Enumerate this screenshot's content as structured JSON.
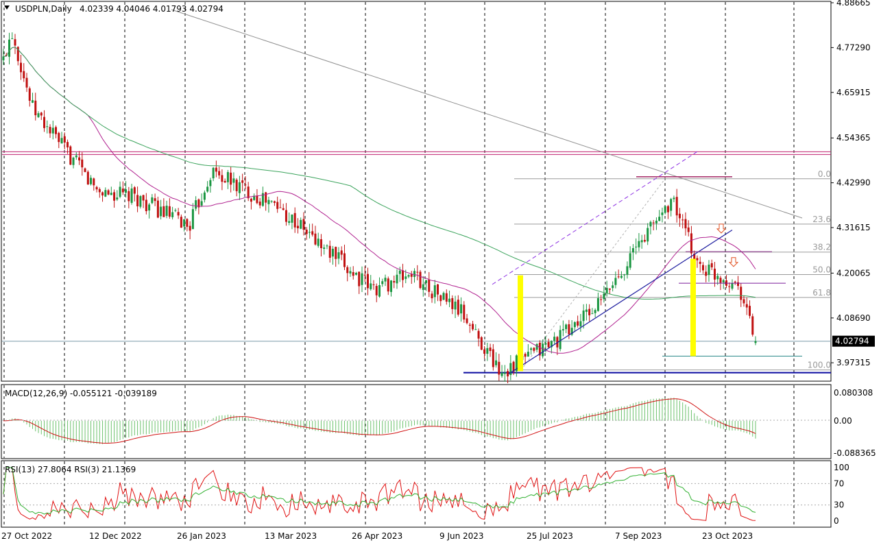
{
  "header": {
    "symbol": "USDPLN,Daily",
    "ohlc": "4.02339 4.04046 4.01793 4.02794",
    "arrow_icon": "triangle-down-icon"
  },
  "price_axis": {
    "labels": [
      "4.88665",
      "4.77290",
      "4.65915",
      "4.54365",
      "4.42990",
      "4.31615",
      "4.20065",
      "4.08690",
      "3.97315"
    ],
    "current_price_label": "4.02794"
  },
  "fib_labels": [
    "0.0",
    "23.6",
    "38.2",
    "50.0",
    "61.8",
    "100.0"
  ],
  "macd": {
    "title": "MACD(12,26,9) -0.055121 -0.039189",
    "axis_labels": [
      "0.080308",
      "0.00",
      "-0.088365"
    ]
  },
  "rsi": {
    "title": "RSI(13) 27.8064  RSI(3) 21.1369",
    "axis_labels": [
      "100",
      "70",
      "30",
      "0"
    ]
  },
  "date_labels": [
    "27 Oct 2022",
    "12 Dec 2022",
    "26 Jan 2023",
    "13 Mar 2023",
    "26 Apr 2023",
    "9 Jun 2023",
    "25 Jul 2023",
    "7 Sep 2023",
    "23 Oct 2023"
  ],
  "colors": {
    "bull": "#1a9641",
    "bear": "#c01010",
    "ma_fast": "#b0208f",
    "ma_slow": "#3aa35b",
    "macd_hist": "#6cc16c",
    "macd_signal": "#d01010",
    "rsi_fast": "#e01010",
    "rsi_slow": "#2fb02f",
    "highlight": "#ffff00",
    "trend_line": "#1f1fa0",
    "support_line": "#0a0aa0",
    "resistance_line": "#c0206f",
    "arrow": "#e05020"
  },
  "chart_data": {
    "type": "candlestick",
    "symbol": "USDPLN",
    "timeframe": "Daily",
    "last_bar": {
      "open": 4.02339,
      "high": 4.04046,
      "low": 4.01793,
      "close": 4.02794
    },
    "y_range": [
      3.93,
      4.88665
    ],
    "date_range": [
      "27 Oct 2022",
      "23 Oct 2023"
    ],
    "close_anchors": [
      {
        "date": "27 Oct 2022",
        "close": 4.74
      },
      {
        "date": "31 Oct 2022",
        "close": 4.82
      },
      {
        "date": "10 Nov 2022",
        "close": 4.62
      },
      {
        "date": "12 Dec 2022",
        "close": 4.41
      },
      {
        "date": "1 Jan 2023",
        "close": 4.39
      },
      {
        "date": "26 Jan 2023",
        "close": 4.32
      },
      {
        "date": "6 Feb 2023",
        "close": 4.46
      },
      {
        "date": "13 Mar 2023",
        "close": 4.36
      },
      {
        "date": "1 Apr 2023",
        "close": 4.27
      },
      {
        "date": "26 Apr 2023",
        "close": 4.16
      },
      {
        "date": "15 May 2023",
        "close": 4.2
      },
      {
        "date": "9 Jun 2023",
        "close": 4.1
      },
      {
        "date": "28 Jun 2023",
        "close": 3.95
      },
      {
        "date": "25 Jul 2023",
        "close": 4.03
      },
      {
        "date": "15 Aug 2023",
        "close": 4.12
      },
      {
        "date": "7 Sep 2023",
        "close": 4.3
      },
      {
        "date": "20 Sep 2023",
        "close": 4.39
      },
      {
        "date": "3 Oct 2023",
        "close": 4.22
      },
      {
        "date": "23 Oct 2023",
        "close": 4.17
      },
      {
        "date": "31 Oct 2023",
        "close": 4.03
      }
    ],
    "horizontal_levels": [
      {
        "name": "resistance",
        "value": 4.505
      },
      {
        "name": "current",
        "value": 4.02794
      },
      {
        "name": "support",
        "value": 3.948
      },
      {
        "name": "recent-low",
        "value": 3.99
      }
    ],
    "fibonacci": {
      "levels": [
        0.0,
        23.6,
        38.2,
        50.0,
        61.8,
        100.0
      ],
      "prices": [
        4.44,
        4.325,
        4.254,
        4.197,
        4.139,
        3.955
      ]
    }
  }
}
